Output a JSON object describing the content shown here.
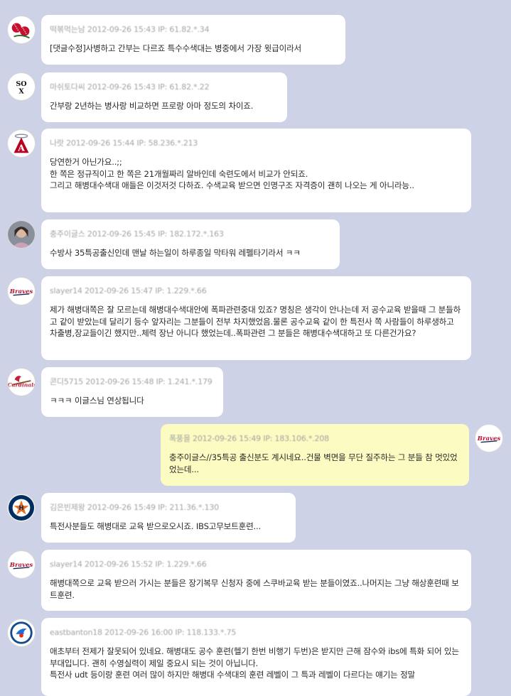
{
  "colors": {
    "background": "#cdd2e6",
    "bubble": "#ffffff",
    "my_bubble": "#fbfbc2",
    "meta": "#a3a3a3"
  },
  "messages": [
    {
      "avatar": "red-sox-logo-icon",
      "meta": "떡볶먹는남  2012-09-26 15:43 IP: 61.82.*.34",
      "text": "[댓글수정]사병하고 간부는 다르죠 특수수색대는 병중에서 가장 윗급이라서"
    },
    {
      "avatar": "white-sox-logo-icon",
      "meta": "마쉬토다씨  2012-09-26 15:43 IP: 61.82.*.22",
      "text": "간부랑 2년하는 병사랑 비교하면 프로랑 아마 정도의 차이죠."
    },
    {
      "avatar": "angels-logo-icon",
      "meta": "나랏  2012-09-26 15:44 IP: 58.236.*.213",
      "text": "당연한거 아닌가요..;;\n한 쪽은 정규직이고 한 쪽은 21개월짜리 알바인데 숙련도에서 비교가 안되죠.\n그리고 해병대수색대 애들은 이것저것 다하죠. 수색교육 받으면 인명구조 자격증이 괜히 나오는 게 아니라능.."
    },
    {
      "avatar": "user-photo-avatar-icon",
      "meta": "충주이글스  2012-09-26 15:45 IP: 182.172.*.163",
      "text": "수방사 35특공출신인데 맨날 하는일이 하루종일 막타워 레펠타기라서 ㅋㅋ"
    },
    {
      "avatar": "braves-logo-icon",
      "meta": "slayer14  2012-09-26 15:47 IP: 1.229.*.66",
      "text": "제가 해병대쪽은 잘 모르는데 해병대수색대안에 폭파관련중대 있죠? 명칭은 생각이 안나는데 저 공수교육 받을때 그 분들하고 같이 받았는데 달리기 등수 앞자리는 그분들이 전부 차지했었음.물론 공수교육 같이 한 특전사 쪽 사람들이 하루생하고 차출병,장교들이긴 했지만..체력 장난 아니다 했었는데..폭파관련 그 분들은 해병대수색대하고 또 다른건가요?"
    },
    {
      "avatar": "cardinals-logo-icon",
      "meta": "콘디5715  2012-09-26 15:48 IP: 1.241.*.179",
      "text": "ㅋㅋㅋ 이글스님 연상됩니다"
    },
    {
      "avatar": "braves-logo-icon",
      "mine": true,
      "meta": "폭풍을  2012-09-26 15:49 IP: 183.106.*.208",
      "text": "충주이글스//35특공 출신분도 계시네요..건물 벽면을 무단 질주하는 그 분들 참 멋있었었는데..."
    },
    {
      "avatar": "astros-logo-icon",
      "meta": "김은빈제왕  2012-09-26 15:49 IP: 211.36.*.130",
      "text": "특전사분들도 해병대로 교육 받으로오시죠. IBS고무보트훈련..."
    },
    {
      "avatar": "braves-logo-icon",
      "meta": "slayer14  2012-09-26 15:52 IP: 1.229.*.66",
      "text": "해병대쪽으로 교육 받으러 가시는 분들은 장기복무 신청자 중에 스쿠바교육 받는 분들이였죠..나머지는 그냥 해상훈련때 보트훈련."
    },
    {
      "avatar": "blue-jays-logo-icon",
      "meta": "eastbanton18  2012-09-26 16:00 IP: 118.133.*.75",
      "text": "애초부터 전제가 잘못되어 있네요. 해병대도 공수 훈련(헬기 한번 비행기 두번)은 받지만 근해 잠수와 ibs에 특화 되어 있는 부대입니다. 괜히 수영실력이 제일 중요시 되는 것이 아닙니다.\n특전사 udt 등이랑 훈련 여러 많이 하지만 해병대 수색대의 훈련 레벨이 그 특과 레벨이 다르다는 얘기는 정말"
    }
  ]
}
